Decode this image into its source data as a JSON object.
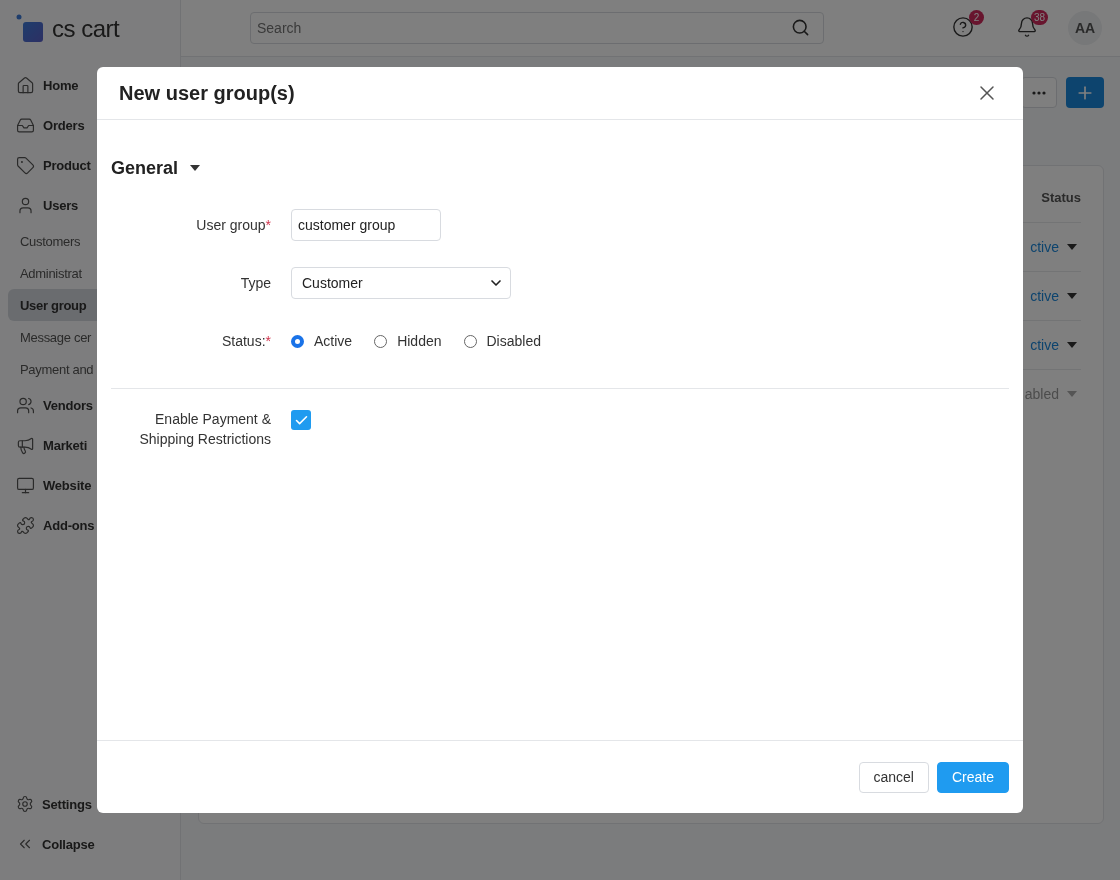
{
  "logo": {
    "text": "cs cart"
  },
  "search": {
    "placeholder": "Search"
  },
  "header_icons": [
    {
      "kind": "help",
      "count": "2"
    },
    {
      "kind": "bell",
      "count": "38"
    }
  ],
  "avatar": {
    "initials": "AA"
  },
  "sidebar": {
    "items": [
      {
        "label": "Home",
        "kind": "main",
        "selected": false
      },
      {
        "label": "Orders",
        "kind": "main",
        "selected": false
      },
      {
        "label": "Product",
        "kind": "main",
        "selected": false
      },
      {
        "label": "Users",
        "kind": "main",
        "selected": false
      },
      {
        "label": "Customers",
        "kind": "sub",
        "selected": false
      },
      {
        "label": "Administrat",
        "kind": "sub",
        "selected": false
      },
      {
        "label": "User group",
        "kind": "sub",
        "selected": true
      },
      {
        "label": "Message cer",
        "kind": "sub",
        "selected": false
      },
      {
        "label": "Payment and",
        "kind": "sub",
        "selected": false
      },
      {
        "label": "Vendors",
        "kind": "main",
        "selected": false
      },
      {
        "label": "Marketi",
        "kind": "main",
        "selected": false
      },
      {
        "label": "Website",
        "kind": "main",
        "selected": false
      },
      {
        "label": "Add-ons",
        "kind": "main",
        "selected": false
      }
    ],
    "footer": [
      {
        "label": "Settings",
        "kind": "settings"
      },
      {
        "label": "Collapse",
        "kind": "collapse"
      }
    ]
  },
  "table": {
    "columns": [
      "Status"
    ],
    "rows": [
      {
        "status": "ctive",
        "kind": "active"
      },
      {
        "status": "ctive",
        "kind": "active"
      },
      {
        "status": "ctive",
        "kind": "active"
      },
      {
        "status": "abled",
        "kind": "disabled"
      }
    ]
  },
  "dialog": {
    "title": "New user group(s)",
    "required_mark": "*",
    "section": {
      "title": "General",
      "expanded": true
    },
    "fields": [
      {
        "label": "User group",
        "kind": "text",
        "required": true,
        "value": "customer group"
      },
      {
        "label": "Type",
        "kind": "select",
        "required": false,
        "value": "Customer"
      },
      {
        "label": "Status:",
        "kind": "radio",
        "required": true,
        "options": [
          {
            "label": "Active",
            "selected": true
          },
          {
            "label": "Hidden",
            "selected": false
          },
          {
            "label": "Disabled",
            "selected": false
          }
        ]
      },
      {
        "label": "Enable Payment & Shipping Restrictions",
        "kind": "checkbox",
        "required": false,
        "checked": true
      }
    ],
    "buttons": [
      {
        "label": "cancel",
        "kind": "secondary"
      },
      {
        "label": "Create",
        "kind": "primary"
      }
    ]
  }
}
